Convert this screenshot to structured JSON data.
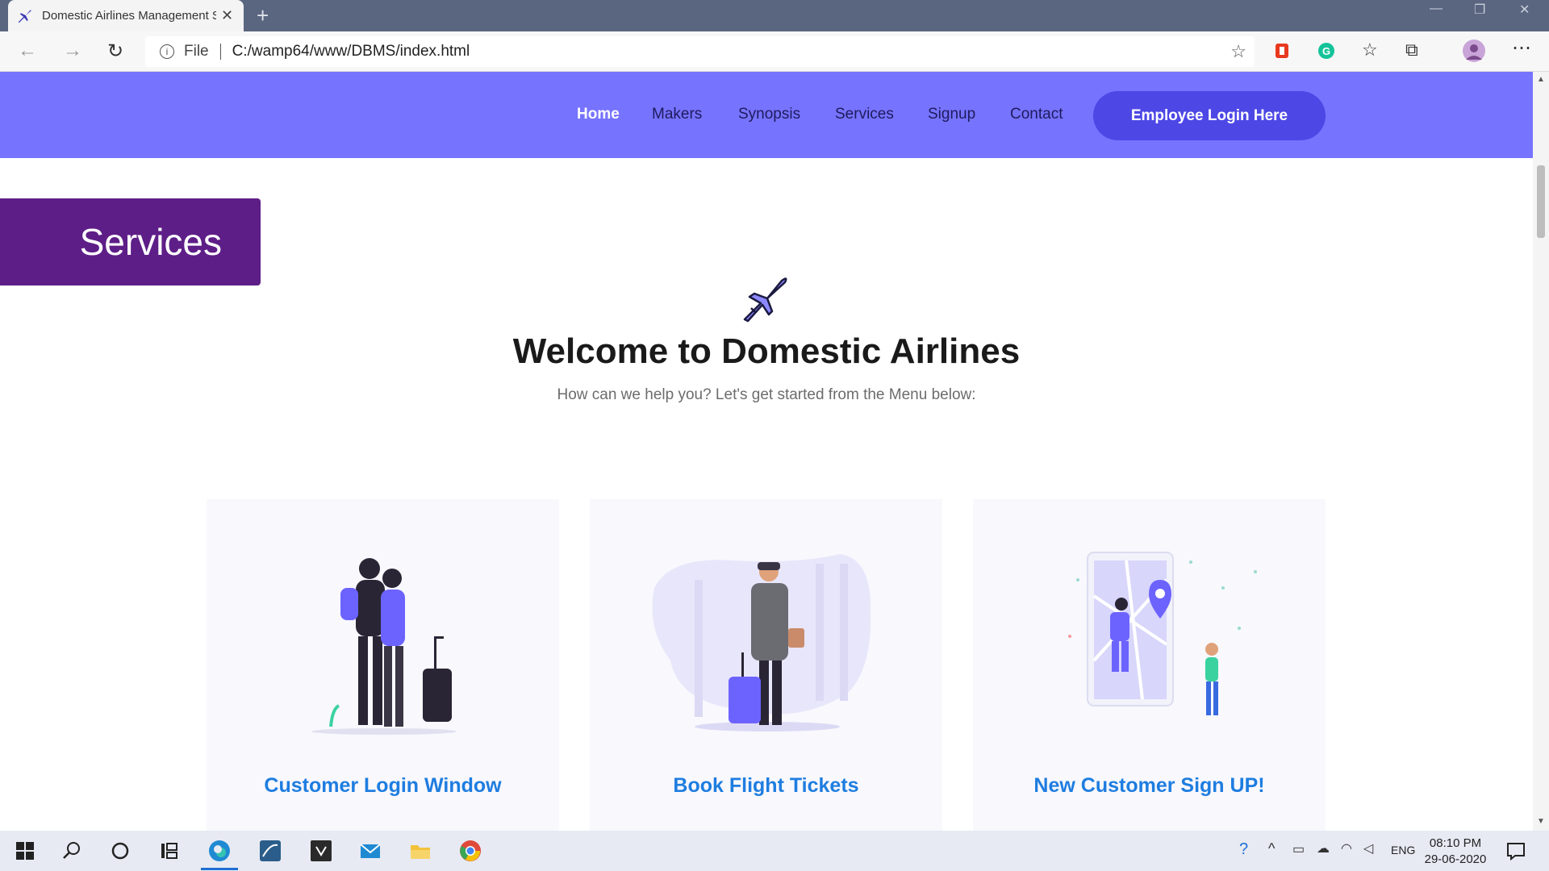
{
  "browser": {
    "tab_title": "Domestic Airlines Management S",
    "address_scheme": "File",
    "address_url": "C:/wamp64/www/DBMS/index.html"
  },
  "site": {
    "nav": [
      "Home",
      "Makers",
      "Synopsis",
      "Services",
      "Signup",
      "Contact"
    ],
    "employee_login": "Employee Login Here",
    "services_banner": "Services",
    "welcome_title": "Welcome to Domestic Airlines",
    "welcome_subtitle": "How can we help you? Let's get started from the Menu below:",
    "cards": [
      {
        "label": "Customer Login Window",
        "icon": "travelers-illustration"
      },
      {
        "label": "Book Flight Tickets",
        "icon": "traveler-with-suitcase-illustration"
      },
      {
        "label": "New Customer Sign UP!",
        "icon": "map-phone-illustration"
      }
    ],
    "colors": {
      "header": "#7673ff",
      "button": "#4d47e6",
      "banner": "#5e1e87",
      "card_label": "#1e7de0"
    }
  },
  "taskbar": {
    "time": "08:10 PM",
    "date": "29-06-2020",
    "lang": "ENG"
  }
}
